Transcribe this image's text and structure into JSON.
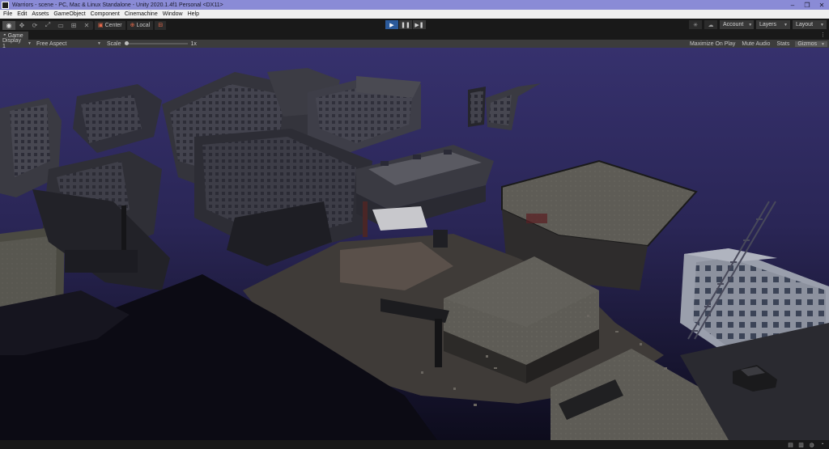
{
  "window": {
    "title": "Warriors - scene - PC, Mac & Linux Standalone - Unity 2020.1.4f1 Personal <DX11>",
    "minimize": "–",
    "maximize": "❐",
    "close": "✕"
  },
  "menu": [
    "File",
    "Edit",
    "Assets",
    "GameObject",
    "Component",
    "Cinemachine",
    "Window",
    "Help"
  ],
  "toolbar": {
    "pivot_center": "Center",
    "pivot_local": "Local",
    "account": "Account",
    "layers": "Layers",
    "layout": "Layout"
  },
  "game_tab": {
    "label": "Game",
    "display": "Display 1",
    "aspect": "Free Aspect",
    "scale_label": "Scale",
    "scale_value": "1x",
    "maximize_on_play": "Maximize On Play",
    "mute_audio": "Mute Audio",
    "stats": "Stats",
    "gizmos": "Gizmos"
  },
  "colors": {
    "titlebar": "#8a8bd6",
    "sky_top": "#36316d",
    "sky_bottom": "#0d0c1c",
    "play_active": "#2b5a9b"
  }
}
